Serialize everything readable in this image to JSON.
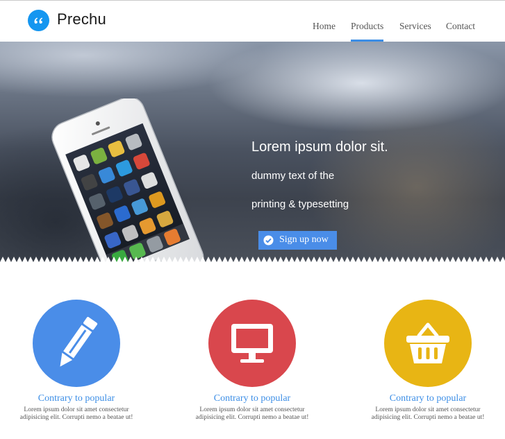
{
  "header": {
    "logo_text": "Prechu",
    "nav": [
      {
        "label": "Home"
      },
      {
        "label": "Products",
        "active": true
      },
      {
        "label": "Services"
      },
      {
        "label": "Contact"
      }
    ],
    "accent_color": "#3c8ee6"
  },
  "hero": {
    "title": "Lorem ipsum dolor sit.",
    "line1": "dummy text of the",
    "line2": "printing & typesetting",
    "cta_label": "Sign up now",
    "cta_icon": "check-circle-icon"
  },
  "features": [
    {
      "icon": "pencil-icon",
      "color": "#4a8de8",
      "title": "Contrary to popular",
      "desc_line1": "Lorem ipsum dolor sit amet consectetur",
      "desc_line2": "adipisicing elit. Corrupti nemo a beatae ut!"
    },
    {
      "icon": "monitor-icon",
      "color": "#d9474d",
      "title": "Contrary to popular",
      "desc_line1": "Lorem ipsum dolor sit amet consectetur",
      "desc_line2": "adipisicing elit. Corrupti nemo a beatae ut!"
    },
    {
      "icon": "basket-icon",
      "color": "#e8b514",
      "title": "Contrary to popular",
      "desc_line1": "Lorem ipsum dolor sit amet consectetur",
      "desc_line2": "adipisicing elit. Corrupti nemo a beatae ut!"
    }
  ]
}
